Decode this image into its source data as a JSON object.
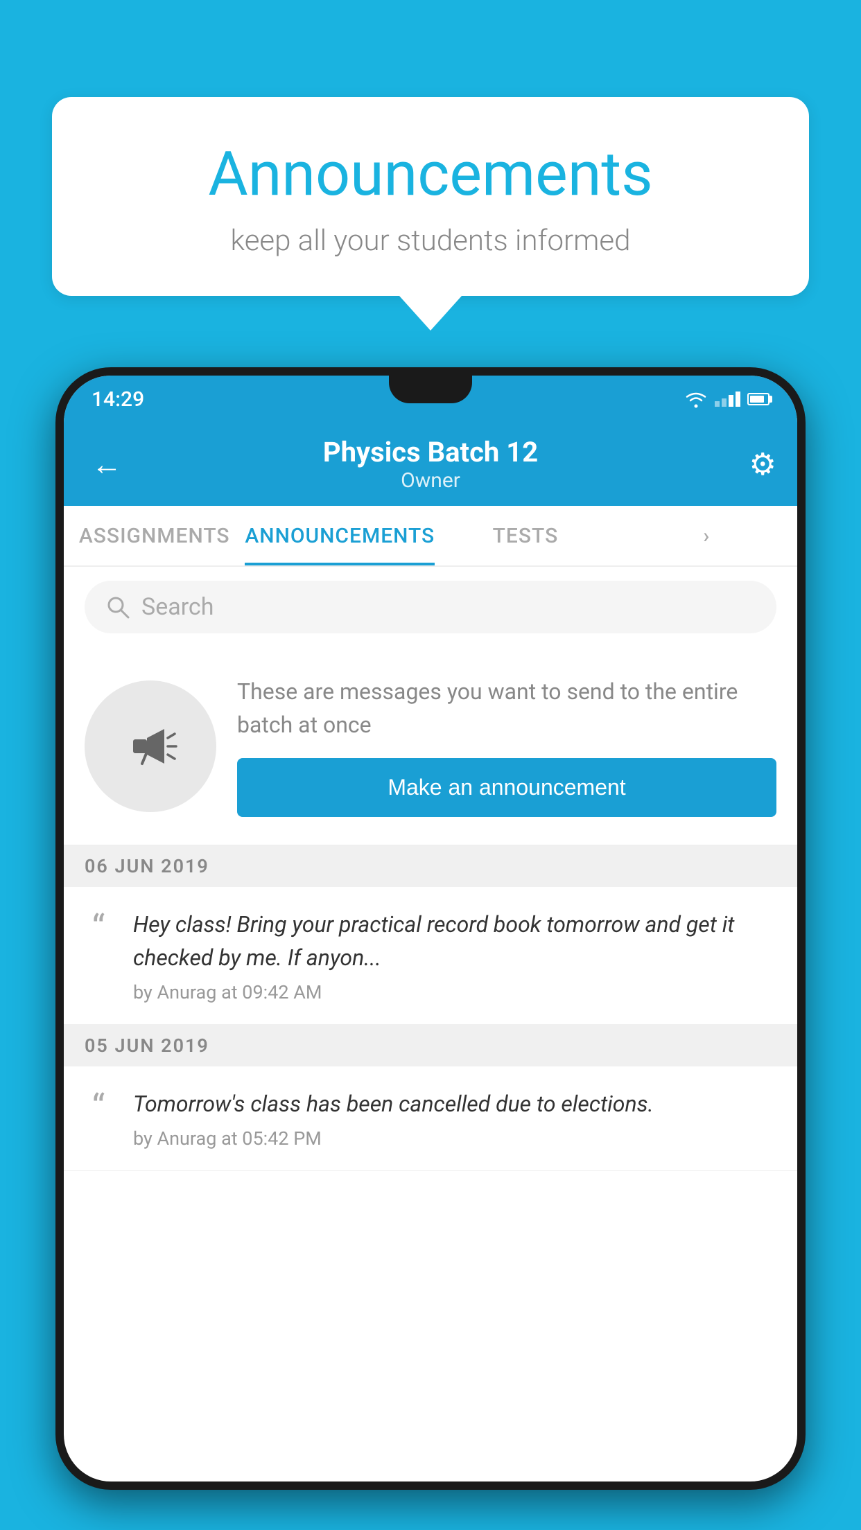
{
  "bubble": {
    "title": "Announcements",
    "subtitle": "keep all your students informed"
  },
  "phone": {
    "statusBar": {
      "time": "14:29"
    },
    "appBar": {
      "title": "Physics Batch 12",
      "subtitle": "Owner",
      "backLabel": "←",
      "gearLabel": "⚙"
    },
    "tabs": [
      {
        "label": "ASSIGNMENTS",
        "active": false
      },
      {
        "label": "ANNOUNCEMENTS",
        "active": true
      },
      {
        "label": "TESTS",
        "active": false
      },
      {
        "label": "",
        "active": false
      }
    ],
    "search": {
      "placeholder": "Search"
    },
    "cta": {
      "description": "These are messages you want to send to the entire batch at once",
      "buttonLabel": "Make an announcement"
    },
    "announcements": [
      {
        "date": "06  JUN  2019",
        "items": [
          {
            "text": "Hey class! Bring your practical record book tomorrow and get it checked by me. If anyon...",
            "meta": "by Anurag at 09:42 AM"
          }
        ]
      },
      {
        "date": "05  JUN  2019",
        "items": [
          {
            "text": "Tomorrow's class has been cancelled due to elections.",
            "meta": "by Anurag at 05:42 PM"
          }
        ]
      }
    ]
  }
}
